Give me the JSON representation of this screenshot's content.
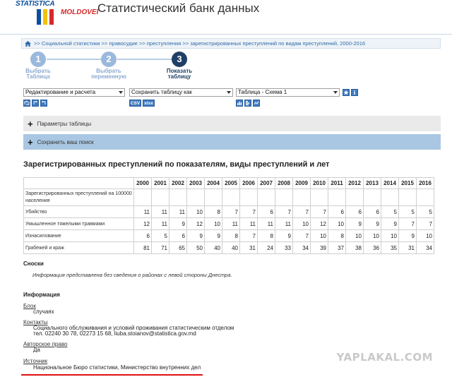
{
  "header": {
    "logo_top": "STATISTICA",
    "logo_bottom": "MOLDOVEI",
    "site_title": "Статистический банк данных",
    "brand_colors": {
      "blue": "#0a4f9e",
      "red": "#d62a2a",
      "yellow": "#f4c20d"
    }
  },
  "breadcrumb": {
    "text": ">> Социальной статистики >> правосудие >> преступления >> зарегистрированных преступлений по видам преступлений, 2000-2016"
  },
  "steps": [
    {
      "number": "1",
      "line1": "Выбрать",
      "line2": "Таблица"
    },
    {
      "number": "2",
      "line1": "Выбрать",
      "line2": "переменную"
    },
    {
      "number": "3",
      "line1": "Показать",
      "line2": "таблицу"
    }
  ],
  "toolbar": {
    "edit_select": "Редактирование и расчета",
    "save_select": "Сохранить таблицу как",
    "view_select": "Таблица - Схема 1",
    "csv": "CSV",
    "xlsx": "xlsx"
  },
  "panels": {
    "params": "Параметры таблицы",
    "save_search": "Сохранить ваш поиск"
  },
  "table": {
    "title": "Зарегистрированных преступлений по показателям, виды преступлений и лет",
    "header_label": "Зарегистрированных преступлений на 100000 населения",
    "years": [
      "2000",
      "2001",
      "2002",
      "2003",
      "2004",
      "2005",
      "2006",
      "2007",
      "2008",
      "2009",
      "2010",
      "2011",
      "2012",
      "2013",
      "2014",
      "2015",
      "2016"
    ],
    "rows": [
      {
        "label": "Убийство",
        "values": [
          "11",
          "11",
          "11",
          "10",
          "8",
          "7",
          "7",
          "6",
          "7",
          "7",
          "7",
          "6",
          "6",
          "6",
          "5",
          "5",
          "5"
        ]
      },
      {
        "label": "Умышленное тяжелыми травмами",
        "values": [
          "12",
          "11",
          "9",
          "12",
          "10",
          "11",
          "11",
          "11",
          "11",
          "10",
          "12",
          "10",
          "9",
          "9",
          "9",
          "7",
          "7"
        ]
      },
      {
        "label": "Изнасилование",
        "values": [
          "6",
          "5",
          "6",
          "9",
          "9",
          "8",
          "7",
          "8",
          "9",
          "7",
          "10",
          "8",
          "10",
          "10",
          "10",
          "9",
          "10"
        ]
      },
      {
        "label": "Грабежей и краж",
        "values": [
          "81",
          "71",
          "65",
          "50",
          "40",
          "40",
          "31",
          "24",
          "33",
          "34",
          "39",
          "37",
          "38",
          "36",
          "35",
          "31",
          "34"
        ]
      }
    ]
  },
  "footnotes": {
    "heading": "Сноски",
    "text": "Информация представлена без сведения о районах с левой стороны Днестра."
  },
  "info": {
    "heading": "Информация",
    "block_label": "Блок",
    "block_value": "случаях",
    "contacts_label": "Контакты",
    "contacts_line1": "Социального обслуживания и условий проживания статистическим отделом",
    "contacts_line2": "тел. 02240 30 78, 02273 15 68, liuba.stoianov@statistica.gov.md",
    "copyright_label": "Авторское право",
    "copyright_value": "Да",
    "source_label": "Источник",
    "source_value": "Национальное Бюро статистики, Министерство внутренних дел"
  },
  "watermark": "YAPLAKAL.COM"
}
